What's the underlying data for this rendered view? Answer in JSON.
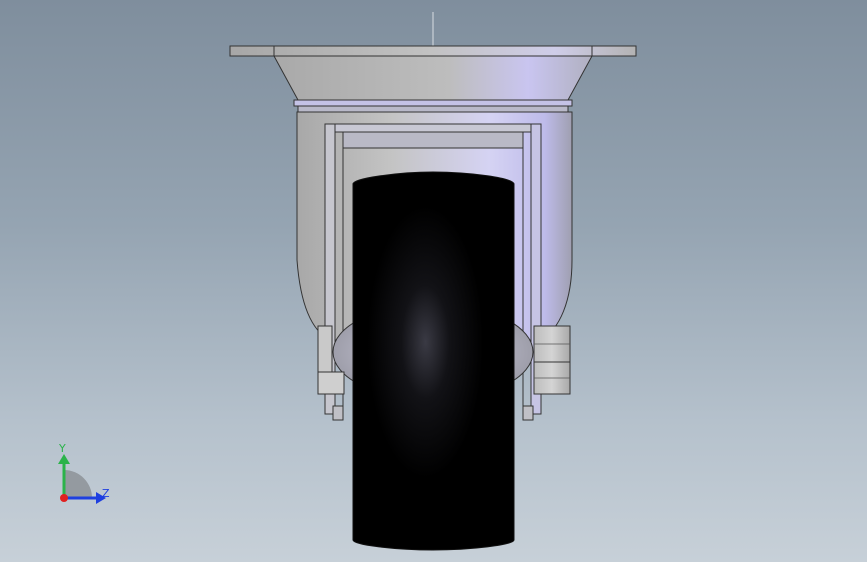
{
  "viewport": {
    "background_top": "#7f8e9d",
    "background_bottom": "#c7d0d8"
  },
  "model": {
    "wheel_color": "#000000",
    "frame_color": "#c8c8c8",
    "plate_color": "#bcbcbc",
    "highlight_color": "#c9c6f5"
  },
  "triad": {
    "y_label": "Y",
    "z_label": "Z",
    "y_color": "#2bb34a",
    "z_color": "#1e3fe0",
    "x_color": "#e02020"
  }
}
